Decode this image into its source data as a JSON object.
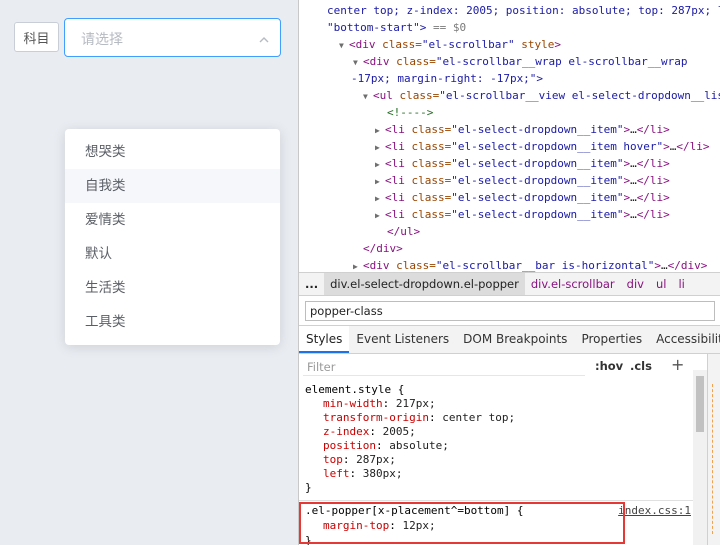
{
  "app": {
    "subject_label": "科目",
    "select_placeholder": "请选择",
    "options": [
      "想哭类",
      "自我类",
      "爱情类",
      "默认",
      "生活类",
      "工具类"
    ],
    "hovered_option": "自我类"
  },
  "devtools": {
    "dom": {
      "line1": "center top; z-index: 2005; position: absolute; top: 287px; l",
      "line2a": "\"bottom-start\">",
      "line2b": " == $0",
      "scrollbar_div_tag": "div",
      "scrollbar_div_attr": "class=",
      "scrollbar_div_val": "\"el-scrollbar\"",
      "scrollbar_div_style": " style",
      "wrap_line_val": "\"el-scrollbar__wrap el-scrollbar__wrap",
      "wrap_line_tail": "-17px; margin-right: -17px;\">",
      "ul_val": "\"el-scrollbar__view el-select-dropdown__lis",
      "comment": "<!---->",
      "li_items": [
        {
          "val": "\"el-select-dropdown__item\""
        },
        {
          "val": "\"el-select-dropdown__item hover\""
        },
        {
          "val": "\"el-select-dropdown__item\""
        },
        {
          "val": "\"el-select-dropdown__item\""
        },
        {
          "val": "\"el-select-dropdown__item\""
        },
        {
          "val": "\"el-select-dropdown__item\""
        }
      ],
      "ellipsis": "…",
      "ul_close": "</ul>",
      "div_close": "</div>",
      "bar_val": "\"el-scrollbar__bar is-horizontal\""
    },
    "breadcrumbs": [
      "...",
      "div.el-select-dropdown.el-popper",
      "div.el-scrollbar",
      "div",
      "ul",
      "li"
    ],
    "search_value": "popper-class",
    "tabs": [
      "Styles",
      "Event Listeners",
      "DOM Breakpoints",
      "Properties",
      "Accessibility"
    ],
    "filter_placeholder": "Filter",
    "hov_label": ":hov",
    "cls_label": ".cls",
    "plus_label": "+",
    "element_style": {
      "selector": "element.style {",
      "props": [
        {
          "name": "min-width",
          "value": "217px;"
        },
        {
          "name": "transform-origin",
          "value": "center top;"
        },
        {
          "name": "z-index",
          "value": "2005;"
        },
        {
          "name": "position",
          "value": "absolute;"
        },
        {
          "name": "top",
          "value": "287px;"
        },
        {
          "name": "left",
          "value": "380px;"
        }
      ],
      "close": "}"
    },
    "popper_rule": {
      "selector": ".el-popper[x-placement^=bottom] {",
      "source": "index.css:1",
      "prop_name": "margin-top",
      "prop_value": "12px;",
      "close": "}"
    }
  }
}
